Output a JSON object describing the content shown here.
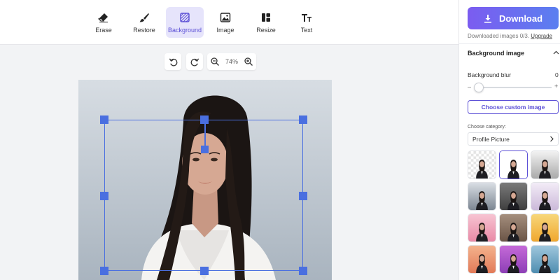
{
  "toolbar": {
    "tools": [
      {
        "label": "Erase",
        "icon": "eraser-icon"
      },
      {
        "label": "Restore",
        "icon": "brush-icon"
      },
      {
        "label": "Background",
        "icon": "background-icon"
      },
      {
        "label": "Image",
        "icon": "image-icon"
      },
      {
        "label": "Resize",
        "icon": "resize-icon"
      },
      {
        "label": "Text",
        "icon": "text-icon"
      }
    ],
    "active_tool": "Background"
  },
  "canvas": {
    "zoom_label": "74%"
  },
  "panel": {
    "download_label": "Download",
    "download_note": "Downloaded images 0/3.",
    "upgrade_label": "Upgrade",
    "section_title": "Background image",
    "blur_label": "Background blur",
    "blur_value": "0",
    "slider_minus": "–",
    "slider_plus": "+",
    "custom_button": "Choose custom image",
    "category_label": "Choose category:",
    "category_value": "Profile Picture"
  },
  "colors": {
    "accent": "#5b4fd6",
    "selection": "#4a6fe0",
    "download_gradient": [
      "#7b5cf0",
      "#5b7ff0"
    ]
  },
  "backgrounds": [
    {
      "type": "transparent"
    },
    {
      "type": "solid",
      "color": "#ffffff",
      "selected": true
    },
    {
      "type": "gradient",
      "colors": [
        "#f2f2f2",
        "#a9a9a9"
      ]
    },
    {
      "type": "gradient",
      "colors": [
        "#d9dee4",
        "#7c8692"
      ]
    },
    {
      "type": "gradient",
      "colors": [
        "#7a7a7a",
        "#3f3f3f"
      ]
    },
    {
      "type": "gradient",
      "colors": [
        "#f3ecf7",
        "#cbb9d9"
      ]
    },
    {
      "type": "gradient",
      "colors": [
        "#f7c4d2",
        "#e98aa6"
      ]
    },
    {
      "type": "gradient",
      "colors": [
        "#a58f7e",
        "#6a5446"
      ]
    },
    {
      "type": "gradient",
      "colors": [
        "#f7d77a",
        "#f0a72e"
      ]
    },
    {
      "type": "gradient",
      "colors": [
        "#f4b38d",
        "#e27a58"
      ]
    },
    {
      "type": "gradient",
      "colors": [
        "#c56ad8",
        "#8d3fb6"
      ]
    },
    {
      "type": "gradient",
      "colors": [
        "#9fc7dd",
        "#4f8db0"
      ]
    }
  ]
}
